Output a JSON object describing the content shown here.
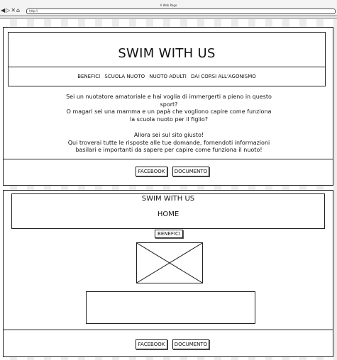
{
  "browser": {
    "window_title": "A Web Page",
    "url": "http://"
  },
  "page1": {
    "site_title": "SWIM WITH US",
    "menu": [
      "BENEFICI",
      "SCUOLA NUOTO",
      "NUOTO ADULTI",
      "DAI CORSI ALL'AGONISMO"
    ],
    "intro_paragraph_1": "Sei un nuotatore amatoriale e hai voglia di  immergerti a pieno in questo\nsport?\nO magari sei una mamma e un papà che vogliono capire come funziona\nla scuola nuoto per il figlio?",
    "intro_paragraph_2": "Allora sei sul sito giusto!\nQui troverai tutte le risposte alle tue domande, fornendoti informazioni\nbasilari e importanti da sapere per capire come funziona il nuoto!",
    "footer_buttons": [
      "FACEBOOK",
      "DOCUMENTO"
    ]
  },
  "page2": {
    "site_title": "SWIM WITH US",
    "page_heading": "HOME",
    "section_button": "BENEFICI",
    "footer_buttons": [
      "FACEBOOK",
      "DOCUMENTO"
    ]
  }
}
